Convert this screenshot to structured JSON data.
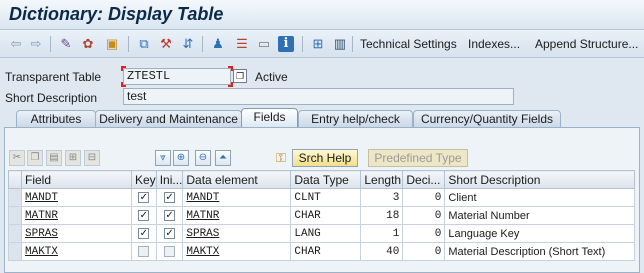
{
  "window": {
    "title": "Dictionary: Display Table"
  },
  "toolbar": {
    "icons": [
      "back-arrow-icon",
      "forward-arrow-icon",
      "glasses-icon",
      "active-inactive-icon",
      "other-object-icon",
      "hierarchy-icon",
      "magic-wand-icon",
      "find-icon",
      "dependencies-icon",
      "tree-icon",
      "frame-icon",
      "info-icon",
      "graphic-icon",
      "table-icon"
    ],
    "technical_settings": "Technical Settings",
    "indexes": "Indexes...",
    "append_structure": "Append Structure..."
  },
  "header": {
    "type_label": "Transparent Table",
    "table_name": "ZTESTL",
    "status": "Active",
    "short_desc_label": "Short Description",
    "short_desc_value": "test"
  },
  "tabs": [
    {
      "label": "Attributes"
    },
    {
      "label": "Delivery and Maintenance"
    },
    {
      "label": "Fields",
      "active": true
    },
    {
      "label": "Entry help/check"
    },
    {
      "label": "Currency/Quantity Fields"
    }
  ],
  "fields_toolbar": {
    "srch_help": "Srch Help",
    "predefined_type": "Predefined Type"
  },
  "grid": {
    "columns": [
      "Field",
      "Key",
      "Ini...",
      "Data element",
      "Data Type",
      "Length",
      "Deci...",
      "Short Description"
    ],
    "rows": [
      {
        "field": "MANDT",
        "key": true,
        "ini": true,
        "data_element": "MANDT",
        "data_type": "CLNT",
        "length": "3",
        "decimals": "0",
        "short_description": "Client"
      },
      {
        "field": "MATNR",
        "key": true,
        "ini": true,
        "data_element": "MATNR",
        "data_type": "CHAR",
        "length": "18",
        "decimals": "0",
        "short_description": "Material Number"
      },
      {
        "field": "SPRAS",
        "key": true,
        "ini": true,
        "data_element": "SPRAS",
        "data_type": "LANG",
        "length": "1",
        "decimals": "0",
        "short_description": "Language Key"
      },
      {
        "field": "MAKTX",
        "key": false,
        "ini": false,
        "data_element": "MAKTX",
        "data_type": "CHAR",
        "length": "40",
        "decimals": "0",
        "short_description": "Material Description (Short Text)"
      }
    ]
  }
}
